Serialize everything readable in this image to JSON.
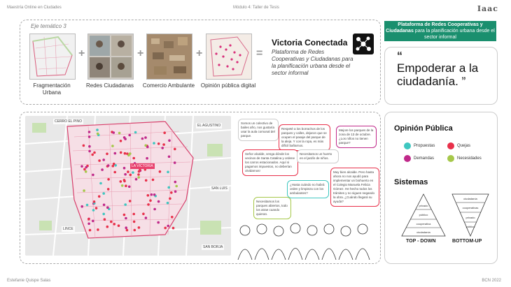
{
  "header": {
    "course": "Maestría Online en Ciudades",
    "module": "Módulo 4: Taller de Tesis",
    "logo": "Iaac"
  },
  "footer": {
    "author": "Estefanie Quispe Salas",
    "place_year": "BCN 2022"
  },
  "theme": {
    "label": "Eje temático 3",
    "items": [
      {
        "caption": "Fragmentación Urbana",
        "icon": "fragmentation-map-icon"
      },
      {
        "caption": "Redes Ciudadanas",
        "icon": "citizen-network-photos-icon"
      },
      {
        "caption": "Comercio Ambulante",
        "icon": "street-commerce-aerial-icon"
      },
      {
        "caption": "Opinión pública digital",
        "icon": "digital-opinion-map-icon"
      }
    ],
    "result_title": "Victoria Conectada",
    "result_subtitle": "Plataforma de Redes Cooperativas y Ciudadanas para la planificación urbana desde el sector informal"
  },
  "callout": {
    "bold": "Plataforma de Redes Cooperativas y Ciudadanas",
    "rest": " para la planificación urbana desde el sector informal"
  },
  "quote": {
    "mark": "“",
    "text": "Empoderar a la ciudadanía. ”"
  },
  "map_labels": {
    "cerro": "CERRO EL PINO",
    "agustino": "EL AGUSTINO",
    "victoria": "LA VICTORIA",
    "sanluis": "SAN LUIS",
    "lince": "LINCE",
    "sanborja": "SAN BORJA"
  },
  "bubbles": [
    "Somos un colectivo de bailes afro, nos gustaría usar la aula comunal del parque.",
    "Respeté a los borrachos de los parques y calles, dejaron que se ocupen el pasaje del parque de la aleja. Y con la ropa, es más difícil bañarnos.",
    "Mejore los parques de la zona de 13 de octubre. ¿Los niños no tienen parque?",
    "Señor alcalde, venga dónde los vecinos de Santa Catalina y ordene los carros estacionados. Aquí si pagamos impuestos, no deberían olvidarnos!",
    "Necesitamos un huerto en el jardín de niños.",
    "¿Hasta cuándo no habrá orden y limpieza con los ambulantes?",
    "Muy bien alcalde. Pero hasta ahora no nos ayudó para implementar un biohuerto en el Colegio Manuela Felicia Gómez. He hecho todos los trámites y no siguen negando la obra. ¿Cuándo llegará su ayuda?",
    "Necesitamos los parques abiertos, todo los atrae cuando quieran."
  ],
  "opinion": {
    "title": "Opinión Pública",
    "legend": [
      {
        "label": "Propuestas",
        "color": "#3fc7c0"
      },
      {
        "label": "Quejas",
        "color": "#e8304a"
      },
      {
        "label": "Demandas",
        "color": "#c0298a"
      },
      {
        "label": "Necesidades",
        "color": "#a6c84a"
      }
    ]
  },
  "systems": {
    "title": "Sistemas",
    "top_down": {
      "label": "TOP - DOWN",
      "levels": [
        "privado",
        "público",
        "cooperativa",
        "ciudadanía"
      ]
    },
    "bottom_up": {
      "label": "BOTTOM-UP",
      "levels": [
        "ciudadanía",
        "cooperativas",
        "privado",
        "público"
      ]
    }
  }
}
